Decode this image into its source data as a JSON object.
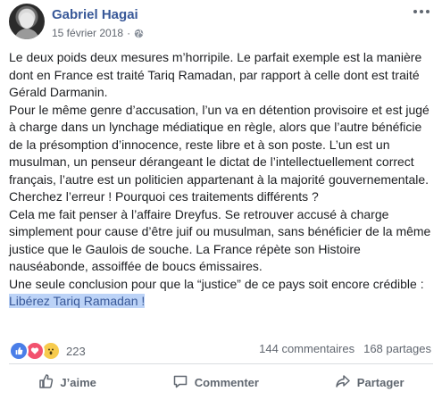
{
  "post": {
    "author": "Gabriel Hagai",
    "date": "15 février 2018",
    "separator": "·",
    "privacy_icon": "globe-icon",
    "paragraphs": [
      "Le deux poids deux mesures m’horripile. Le parfait exemple est la manière dont en France est traité Tariq Ramadan, par rapport à celle dont est traité Gérald Darmanin.",
      "Pour le même genre d’accusation, l’un va en détention provisoire et est jugé à charge dans un lynchage médiatique en règle, alors que l’autre bénéficie de la présomption d’innocence, reste libre et à son poste. L’un est un musulman, un penseur dérangeant le dictat de l’intellectuellement correct français, l’autre est un politicien appartenant à la majorité gouvernementale. Cherchez l’erreur ! Pourquoi ces traitements différents ?",
      "Cela me fait penser à l’affaire Dreyfus. Se retrouver accusé à charge simplement pour cause d’être juif ou musulman, sans bénéficier de la même justice que le Gaulois de souche. La France répète son Histoire nauséabonde, assoiffée de boucs émissaires."
    ],
    "conclusion_prefix": "Une seule conclusion pour que la “justice” de ce pays soit encore crédible : ",
    "conclusion_highlight": "Libérez Tariq Ramadan !"
  },
  "reactions": {
    "icons": [
      "like-icon",
      "love-icon",
      "wow-icon"
    ],
    "count": "223",
    "comments": "144 commentaires",
    "shares": "168 partages"
  },
  "actions": {
    "like": "J’aime",
    "comment": "Commenter",
    "share": "Partager"
  },
  "colors": {
    "author": "#385898",
    "highlight_bg": "#bcd3f7",
    "meta": "#616770"
  }
}
